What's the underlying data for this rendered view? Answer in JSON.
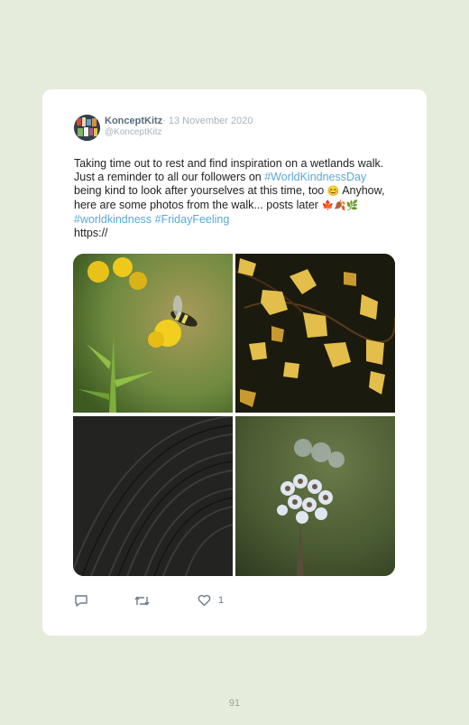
{
  "tweet": {
    "author_name": "KonceptKitz",
    "date": "· 13 November 2020",
    "handle": "@KonceptKitz",
    "text_1": "Taking time out to rest and find inspiration on a wetlands walk. Just a reminder to all our followers on ",
    "hashtag_1": "#WorldKindnessDay",
    "text_2": " being kind to look after yourselves at this time, too ",
    "emoji_1": "😊",
    "text_3": " Anyhow, here are some photos from the walk... posts later ",
    "emoji_2": "🍁🍂🌿",
    "hashtag_2": " #worldkindness",
    "hashtag_3": " #FridayFeeling",
    "text_4": "https://",
    "like_count": "1"
  },
  "photos": [
    {
      "subject": "insect on yellow flowers"
    },
    {
      "subject": "yellow autumn leaves"
    },
    {
      "subject": "dark wood texture"
    },
    {
      "subject": "pale flower cluster"
    }
  ],
  "icons": {
    "reply": "reply-icon",
    "retweet": "retweet-icon",
    "like": "heart-icon"
  },
  "colors": {
    "background": "#e6ecdc",
    "card": "#ffffff",
    "hashtag": "#5aa9d6",
    "name": "#586b7d",
    "muted": "#a7b3bd"
  },
  "footer": {
    "page_number": "91"
  }
}
